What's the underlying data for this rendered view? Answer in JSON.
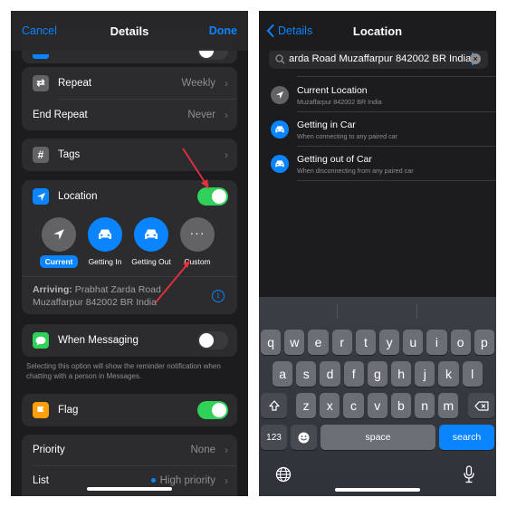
{
  "left_screen": {
    "navbar": {
      "cancel": "Cancel",
      "title": "Details",
      "done": "Done"
    },
    "repeat_card": {
      "repeat": {
        "label": "Repeat",
        "value": "Weekly",
        "icon": "repeat-icon"
      },
      "end_repeat": {
        "label": "End Repeat",
        "value": "Never"
      }
    },
    "tags": {
      "label": "Tags",
      "icon": "hashtag-icon"
    },
    "location": {
      "label": "Location",
      "icon": "location-arrow-icon",
      "enabled": true,
      "options": [
        {
          "label": "Current",
          "icon": "location-arrow-icon",
          "selected": true
        },
        {
          "label": "Getting In",
          "icon": "car-icon",
          "selected": false
        },
        {
          "label": "Getting Out",
          "icon": "car-icon",
          "selected": false
        },
        {
          "label": "Custom",
          "icon": "ellipsis-icon",
          "selected": false
        }
      ],
      "arriving_prefix": "Arriving:",
      "arriving_line1": "Prabhat Zarda Road",
      "arriving_line2": "Muzaffarpur 842002 BR India"
    },
    "messaging": {
      "label": "When Messaging",
      "icon": "messages-icon",
      "enabled": false,
      "footnote": "Selecting this option will show the reminder notification when chatting with a person in Messages."
    },
    "flag": {
      "label": "Flag",
      "icon": "flag-icon",
      "enabled": true
    },
    "bottom_card": {
      "priority": {
        "label": "Priority",
        "value": "None"
      },
      "list": {
        "label": "List",
        "value": "High priority",
        "dot_color": "#0a84ff"
      }
    }
  },
  "right_screen": {
    "navbar": {
      "back": "Details",
      "title": "Location"
    },
    "search": {
      "value": "arda Road Muzaffarpur 842002 BR India"
    },
    "suggestions": [
      {
        "title": "Current Location",
        "subtitle": "Muzaffarpur 842002 BR India",
        "icon": "location-arrow-icon"
      },
      {
        "title": "Getting in Car",
        "subtitle": "When connecting to any paired car",
        "icon": "car-icon"
      },
      {
        "title": "Getting out of Car",
        "subtitle": "When disconnecting from any paired car",
        "icon": "car-icon"
      }
    ],
    "keyboard": {
      "row1": [
        "q",
        "w",
        "e",
        "r",
        "t",
        "y",
        "u",
        "i",
        "o",
        "p"
      ],
      "row2": [
        "a",
        "s",
        "d",
        "f",
        "g",
        "h",
        "j",
        "k",
        "l"
      ],
      "row3": [
        "z",
        "x",
        "c",
        "v",
        "b",
        "n",
        "m"
      ],
      "numbers": "123",
      "space": "space",
      "search": "search"
    }
  },
  "colors": {
    "accent": "#0a84ff",
    "toggle_on": "#30d158",
    "flag": "#ff9f0a",
    "messages": "#30d158",
    "annotation_arrow": "#e5303f"
  }
}
